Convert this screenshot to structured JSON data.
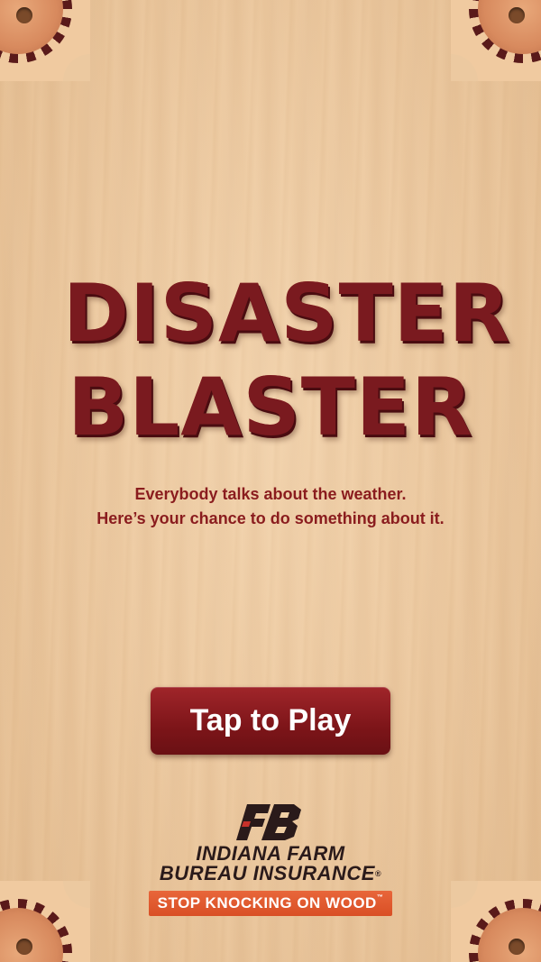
{
  "game": {
    "title_line1": "DISASTER",
    "title_line2": "BLASTER",
    "tagline_line1": "Everybody talks about the weather.",
    "tagline_line2": "Here’s your chance to do something about it."
  },
  "play_button": {
    "label": "Tap to Play"
  },
  "brand": {
    "name_line1": "INDIANA FARM",
    "name_line2": "BUREAU INSURANCE",
    "registered": "®",
    "slogan": "STOP KNOCKING ON WOOD",
    "slogan_tm": "™"
  },
  "colors": {
    "title": "#7a1a1f",
    "tagline": "#8a1c1e",
    "button": "#8c1b20",
    "slogan_bg": "#e05a2e",
    "wood": "#ecc9a0"
  },
  "icons": {
    "logo": "farm-bureau-fb-logo",
    "corner": "gear-corner"
  }
}
